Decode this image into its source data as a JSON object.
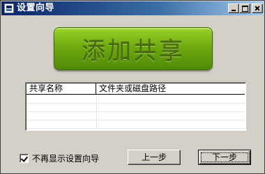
{
  "window": {
    "title": "设置向导",
    "icon": "app-window-icon"
  },
  "titlebar_buttons": {
    "minimize": "minimize-icon",
    "maximize": "maximize-icon",
    "close": "close-icon"
  },
  "banner": {
    "text": "添加共享",
    "color": "#6fa90f"
  },
  "share_list": {
    "columns": [
      "共享名称",
      "文件夹或磁盘路径"
    ],
    "rows": []
  },
  "options": {
    "dont_show_again_label": "不再显示设置向导",
    "dont_show_again_checked": true
  },
  "buttons": {
    "prev_label": "上一步",
    "next_label": "下一步"
  }
}
